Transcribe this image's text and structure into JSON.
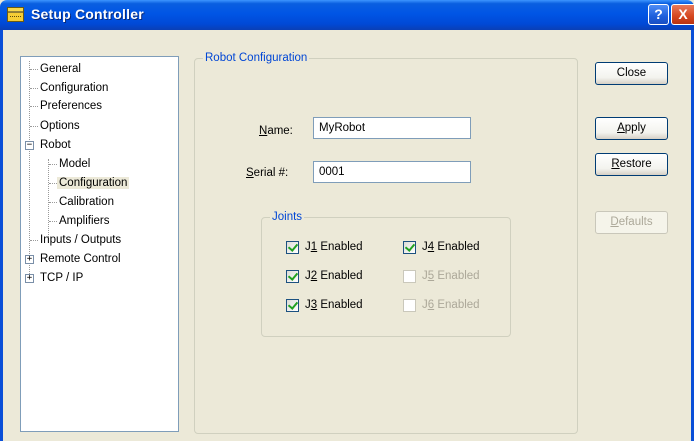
{
  "window": {
    "title": "Setup Controller",
    "help_button": "?",
    "close_button": "X"
  },
  "tree": {
    "items": [
      {
        "label": "General"
      },
      {
        "label": "Configuration"
      },
      {
        "label": "Preferences"
      },
      {
        "label": "Options"
      },
      {
        "label": "Robot",
        "expander": "−"
      },
      {
        "label": "Model"
      },
      {
        "label": "Configuration",
        "selected": true
      },
      {
        "label": "Calibration"
      },
      {
        "label": "Amplifiers"
      },
      {
        "label": "Inputs / Outputs"
      },
      {
        "label": "Remote Control",
        "expander": "+"
      },
      {
        "label": "TCP / IP",
        "expander": "+"
      }
    ]
  },
  "robot_config": {
    "legend": "Robot Configuration",
    "name_label_prefix": "",
    "name_label_underlined": "N",
    "name_label_rest": "ame:",
    "name_value": "MyRobot",
    "serial_label_underlined": "S",
    "serial_label_rest": "erial #:",
    "serial_value": "0001"
  },
  "joints": {
    "legend": "Joints",
    "items": [
      {
        "prefix": "J",
        "underlined": "1",
        "suffix": " Enabled",
        "checked": true,
        "disabled": false
      },
      {
        "prefix": "J",
        "underlined": "2",
        "suffix": " Enabled",
        "checked": true,
        "disabled": false
      },
      {
        "prefix": "J",
        "underlined": "3",
        "suffix": " Enabled",
        "checked": true,
        "disabled": false
      },
      {
        "prefix": "J",
        "underlined": "4",
        "suffix": " Enabled",
        "checked": true,
        "disabled": false
      },
      {
        "prefix": "J",
        "underlined": "5",
        "suffix": " Enabled",
        "checked": false,
        "disabled": true
      },
      {
        "prefix": "J",
        "underlined": "6",
        "suffix": " Enabled",
        "checked": false,
        "disabled": true
      }
    ]
  },
  "buttons": {
    "close": "Close",
    "apply_u": "A",
    "apply_rest": "pply",
    "restore_u": "R",
    "restore_rest": "estore",
    "defaults_u": "D",
    "defaults_rest": "efaults"
  },
  "colors": {
    "titlebar": "#0055e5",
    "group_legend": "#0046d5",
    "checkmark": "#21a121",
    "window_bg": "#ece9d8"
  }
}
